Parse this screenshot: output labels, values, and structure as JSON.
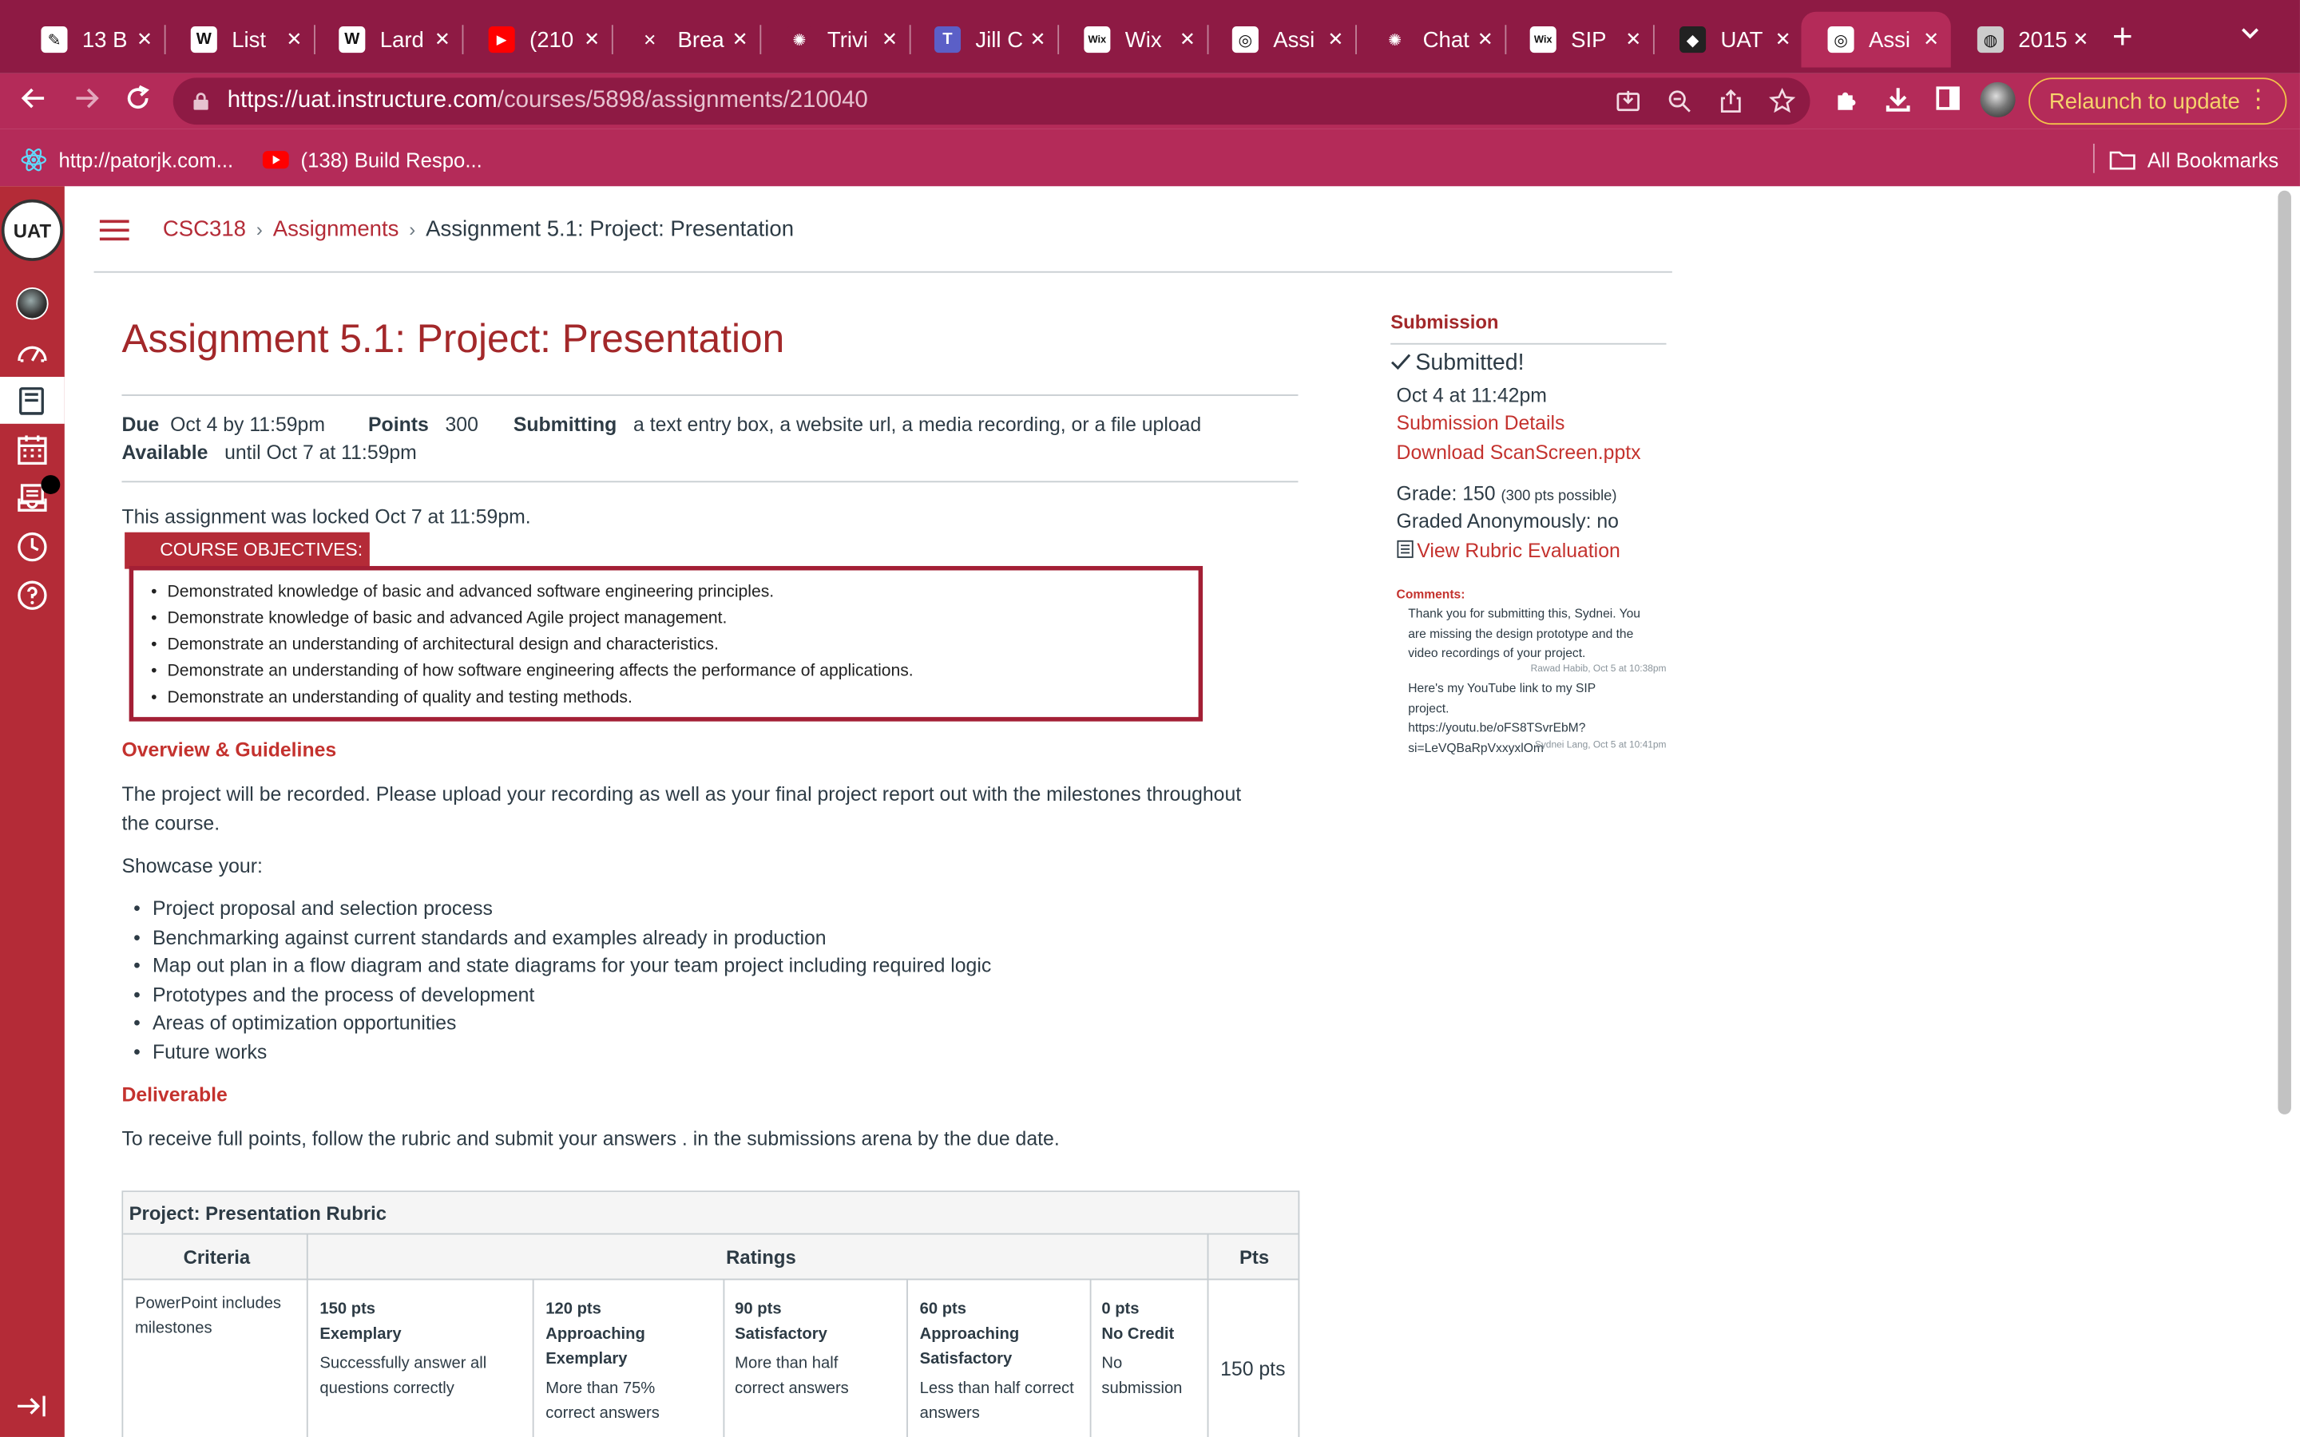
{
  "browser": {
    "tabs": [
      {
        "title": "13 B",
        "icon": "quill-icon",
        "color": "#ffffff"
      },
      {
        "title": "List",
        "icon": "wikipedia-icon",
        "color": "#ffffff"
      },
      {
        "title": "Lard",
        "icon": "wikipedia-icon",
        "color": "#ffffff"
      },
      {
        "title": "(210",
        "icon": "youtube-icon",
        "color": "#ff0000"
      },
      {
        "title": "Brea",
        "icon": "x-icon",
        "color": "#8e1a44"
      },
      {
        "title": "Trivi",
        "icon": "chatgpt-icon",
        "color": "#8e1a44"
      },
      {
        "title": "Jill C",
        "icon": "teams-icon",
        "color": "#5b5fc7"
      },
      {
        "title": "Wix",
        "icon": "wix-icon",
        "color": "#ffffff"
      },
      {
        "title": "Assi",
        "icon": "uat-icon",
        "color": "#ffffff"
      },
      {
        "title": "Chat",
        "icon": "chatgpt-icon",
        "color": "#8e1a44"
      },
      {
        "title": "SIP",
        "icon": "wix-icon",
        "color": "#ffffff"
      },
      {
        "title": "UAT",
        "icon": "uat-dark-icon",
        "color": "#222222"
      },
      {
        "title": "Assi",
        "icon": "uat-icon",
        "color": "#ffffff"
      },
      {
        "title": "2015",
        "icon": "globe-icon",
        "color": "#cccccc"
      }
    ],
    "url_host": "https://uat.instructure.com",
    "url_path": "/courses/5898/assignments/210040",
    "relaunch_label": "Relaunch to update",
    "bookmarks": [
      {
        "label": "http://patorjk.com...",
        "icon": "react-icon"
      },
      {
        "label": "(138) Build Respo...",
        "icon": "youtube-icon"
      }
    ],
    "all_bookmarks_label": "All Bookmarks"
  },
  "breadcrumb": {
    "course": "CSC318",
    "section": "Assignments",
    "current": "Assignment 5.1: Project: Presentation"
  },
  "assignment": {
    "title": "Assignment 5.1: Project: Presentation",
    "due_label": "Due",
    "due_value": "Oct 4 by 11:59pm",
    "points_label": "Points",
    "points_value": "300",
    "submitting_label": "Submitting",
    "submitting_value": "a text entry box, a website url, a media recording, or a file upload",
    "available_label": "Available",
    "available_value": "until Oct 7 at 11:59pm",
    "locked_text": "This assignment was locked Oct 7 at 11:59pm.",
    "objectives_title": "COURSE OBJECTIVES:",
    "objectives": [
      "Demonstrated knowledge of basic and advanced software engineering principles.",
      "Demonstrate knowledge of basic and advanced Agile project management.",
      "Demonstrate an understanding of architectural design and characteristics.",
      "Demonstrate an understanding of how software engineering affects the performance of applications.",
      "Demonstrate an understanding of quality and testing methods."
    ],
    "overview_heading": "Overview & Guidelines",
    "overview_text": "The project will be recorded. Please upload your recording as well as your final project report out with the milestones throughout the course.",
    "showcase_intro": "Showcase your:",
    "showcase_items": [
      "Project proposal and selection process",
      "Benchmarking against current standards and examples already in production",
      "Map out plan in a flow diagram and state diagrams for your team project including required logic",
      "Prototypes and the process of development",
      "Areas of optimization opportunities",
      "Future works"
    ],
    "deliverable_heading": "Deliverable",
    "deliverable_text": "To receive full points, follow the rubric and submit your answers . in the submissions arena by the due date."
  },
  "rubric": {
    "title": "Project: Presentation Rubric",
    "col_criteria": "Criteria",
    "col_ratings": "Ratings",
    "col_pts": "Pts",
    "row": {
      "criterion": "PowerPoint includes milestones",
      "ratings": [
        {
          "pts": "150 pts",
          "label": "Exemplary",
          "desc": "Successfully answer all questions correctly"
        },
        {
          "pts": "120 pts",
          "label": "Approaching Exemplary",
          "desc": "More than 75% correct answers"
        },
        {
          "pts": "90 pts",
          "label": "Satisfactory",
          "desc": "More than half correct answers"
        },
        {
          "pts": "60 pts",
          "label": "Approaching Satisfactory",
          "desc": "Less than half correct answers"
        },
        {
          "pts": "0 pts",
          "label": "No Credit",
          "desc": "No submission"
        }
      ],
      "score": "150 pts"
    }
  },
  "submission": {
    "heading": "Submission",
    "status": "Submitted!",
    "date": "Oct 4 at 11:42pm",
    "details_link": "Submission Details",
    "download_link": "Download ScanScreen.pptx",
    "grade_label": "Grade: 150",
    "grade_possible": "(300 pts possible)",
    "anon": "Graded Anonymously: no",
    "rubric_link": "View Rubric Evaluation",
    "comments_label": "Comments:",
    "comments": [
      {
        "text": "Thank you for submitting this, Sydnei. You are missing the design prototype and the video recordings of your project.",
        "meta": "Rawad Habib, Oct 5 at 10:38pm"
      },
      {
        "text": "Here's my YouTube link to my SIP project. https://youtu.be/oFS8TSvrEbM?si=LeVQBaRpVxxyxlOm",
        "meta": "Sydnei Lang, Oct 5 at 10:41pm"
      }
    ]
  },
  "colors": {
    "brand": "#b42b37",
    "heading": "#a3282a",
    "link": "#c4322e",
    "browser_frame": "#8e1a44",
    "browser_toolbar": "#b42b59"
  }
}
